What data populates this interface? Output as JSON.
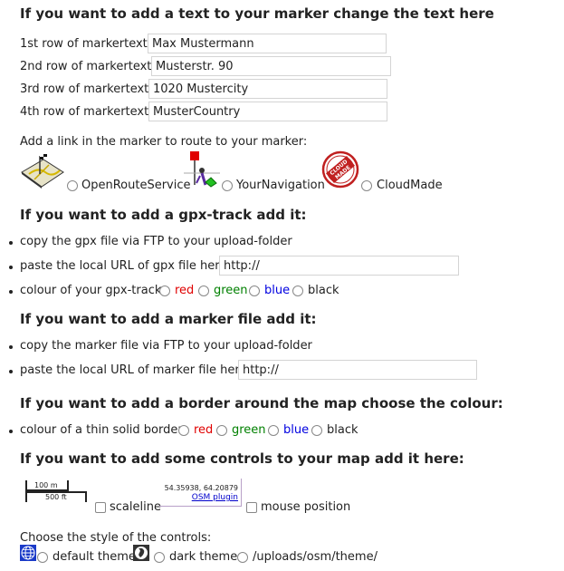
{
  "marker_text": {
    "heading": "If you want to add a text to your marker change the text here",
    "rows": [
      {
        "label": "1st row of markertext:",
        "value": "Max Mustermann"
      },
      {
        "label": "2nd row of markertext:",
        "value": "Musterstr. 90"
      },
      {
        "label": "3rd row of markertext:",
        "value": "1020 Mustercity"
      },
      {
        "label": "4th row of markertext:",
        "value": "MusterCountry"
      }
    ]
  },
  "route_link": {
    "label": "Add a link in the marker to route to your marker:",
    "options": [
      "OpenRouteService",
      "YourNavigation",
      "CloudMade"
    ],
    "cloudmade_logo_text": "CLOUD MADE"
  },
  "gpx": {
    "heading": "If you want to add a gpx-track add it:",
    "step1": "copy the gpx file via FTP to your upload-folder",
    "step2_label": "paste the local URL of gpx file here:",
    "url_value": "http://",
    "colour_label": "colour of your gpx-track:",
    "colours": [
      "red",
      "green",
      "blue",
      "black"
    ]
  },
  "marker_file": {
    "heading": "If you want to add a marker file add it:",
    "step1": "copy the marker file via FTP to your upload-folder",
    "step2_label": "paste the local URL of marker file here:",
    "url_value": "http://"
  },
  "border": {
    "heading": "If you want to add a border around the map choose the colour:",
    "label": "colour of a thin solid border:",
    "colours": [
      "red",
      "green",
      "blue",
      "black"
    ]
  },
  "controls": {
    "heading": "If you want to add some controls to your map add it here:",
    "scale_top": "100 m",
    "scale_bottom": "500 ft",
    "scaleline_label": "scaleline",
    "coords": "54.35938, 64.20879",
    "osm_plugin": "OSM plugin",
    "mouse_position_label": "mouse position"
  },
  "theme": {
    "label": "Choose the style of the controls:",
    "options": [
      "default theme",
      "dark theme",
      "/uploads/osm/theme/"
    ]
  }
}
